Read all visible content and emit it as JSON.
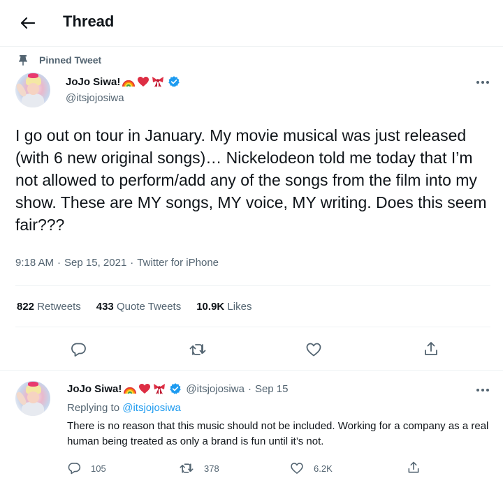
{
  "header": {
    "title": "Thread"
  },
  "pinned": {
    "label": "Pinned Tweet"
  },
  "main_tweet": {
    "author": {
      "display_name": "JoJo Siwa!",
      "handle": "@itsjojosiwa",
      "emojis": [
        "rainbow",
        "heart",
        "ribbon"
      ]
    },
    "text": "I go out on tour in January. My movie musical was just released (with 6 new original songs)… Nickelodeon told me today that I’m not allowed to perform/add any of the songs from the film into my show. These are MY songs, MY voice, MY writing. Does this seem fair???",
    "time": "9:18 AM",
    "date": "Sep 15, 2021",
    "source": "Twitter for iPhone",
    "separator": "·",
    "stats": [
      {
        "count": "822",
        "label": "Retweets"
      },
      {
        "count": "433",
        "label": "Quote Tweets"
      },
      {
        "count": "10.9K",
        "label": "Likes"
      }
    ]
  },
  "reply_tweet": {
    "author": {
      "display_name": "JoJo Siwa!",
      "handle": "@itsjojosiwa",
      "emojis": [
        "rainbow",
        "heart",
        "ribbon"
      ]
    },
    "separator": "·",
    "date": "Sep 15",
    "replying_prefix": "Replying to",
    "replying_to": "@itsjojosiwa",
    "text": "There is no reason that this music should not be included. Working for a company as a real human being treated as only a brand is fun until it’s not.",
    "actions": {
      "replies": "105",
      "retweets": "378",
      "likes": "6.2K"
    }
  },
  "colors": {
    "accent": "#1d9bf0",
    "secondary_text": "#536471",
    "primary_text": "#0f1419",
    "divider": "#eff3f4"
  },
  "icons": [
    "back-arrow-icon",
    "pin-icon",
    "verified-badge-icon",
    "more-icon",
    "reply-icon",
    "retweet-icon",
    "like-icon",
    "share-icon"
  ]
}
